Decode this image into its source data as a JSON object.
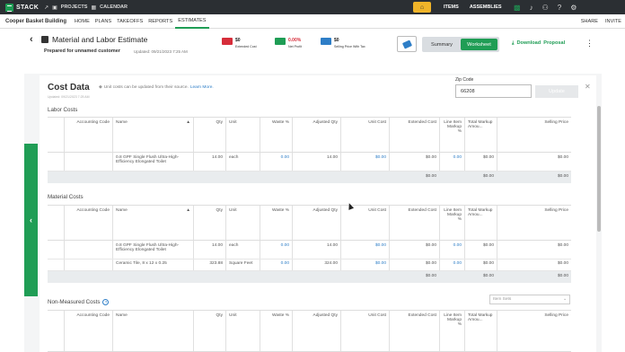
{
  "topbar": {
    "logo": "STACK",
    "nav": [
      {
        "icon": "external-link-icon",
        "glyph": "↗",
        "label": ""
      },
      {
        "icon": "projects-icon",
        "glyph": "▣",
        "label": "PROJECTS"
      },
      {
        "icon": "calendar-icon",
        "glyph": "▦",
        "label": "CALENDAR"
      }
    ],
    "items_label": "ITEMS",
    "assemblies_label": "ASSEMBLIES",
    "icons": [
      "apps-icon",
      "bell-icon",
      "users-icon",
      "help-icon",
      "settings-icon"
    ]
  },
  "subnav": {
    "project": "Cooper Basket Building",
    "items": [
      "HOME",
      "PLANS",
      "TAKEOFFS",
      "REPORTS",
      "ESTIMATES"
    ],
    "active": "ESTIMATES",
    "share": "SHARE",
    "invite": "INVITE"
  },
  "header": {
    "title": "Material and Labor Estimate",
    "prepared": "Prepared for unnamed customer",
    "updated": "Updated: 09/21/2023 7:25 AM",
    "stats": [
      {
        "value": "$0",
        "label": "Extended Cost",
        "color": "#d62d3a"
      },
      {
        "value": "0.00%",
        "label": "Net Profit",
        "color": "#1f9d55",
        "valueColor": "#d62d3a"
      },
      {
        "value": "$0",
        "label": "Selling Price With Tax",
        "color": "#2e7ec7"
      }
    ],
    "summary_label": "Summary",
    "worksheet_label": "Worksheet",
    "download_label": "Download",
    "proposal_label": "Proposal"
  },
  "cost_data": {
    "title": "Cost Data",
    "info": "Unit costs can be updated from their source.",
    "learn_more": "Learn More.",
    "updated": "Updated: 09/21/2023 7:25 AM",
    "zip_label": "Zip Code",
    "zip_value": "66208",
    "update_label": "Update"
  },
  "columns": {
    "accounting": "Accounting Code",
    "name": "Name",
    "qty": "Qty",
    "unit": "Unit",
    "waste": "Waste %",
    "adjusted_qty": "Adjusted Qty",
    "unit_cost": "Unit Cost",
    "extended_cost": "Extended Cost",
    "line_markup": "Line Item Markup %",
    "total_markup": "Total Markup Amou...",
    "selling_price": "Selling Price"
  },
  "labor": {
    "title": "Labor Costs",
    "rows": [
      {
        "name": "0.8 GPF Single Flush Ultra-High-Efficiency Elongated Toilet",
        "qty": "14.00",
        "unit": "each",
        "waste": "0.00",
        "adjusted": "14.00",
        "unit_cost": "$0.00",
        "extended": "$0.00",
        "line_markup": "0.00",
        "total_markup": "$0.00",
        "selling": "$0.00"
      }
    ],
    "total": {
      "extended": "$0.00",
      "total_markup": "$0.00",
      "selling": "$0.00"
    }
  },
  "material": {
    "title": "Material Costs",
    "rows": [
      {
        "name": "0.8 GPF Single Flush Ultra-High-Efficiency Elongated Toilet",
        "qty": "14.00",
        "unit": "each",
        "waste": "0.00",
        "adjusted": "14.00",
        "unit_cost": "$0.00",
        "extended": "$0.00",
        "line_markup": "0.00",
        "total_markup": "$0.00",
        "selling": "$0.00"
      },
      {
        "name": "Ceramic Tile, 8 x 12 x 0.25",
        "qty": "323.88",
        "unit": "Square Feet",
        "waste": "0.00",
        "adjusted": "324.00",
        "unit_cost": "$0.00",
        "extended": "$0.00",
        "line_markup": "0.00",
        "total_markup": "$0.00",
        "selling": "$0.00"
      }
    ],
    "total": {
      "extended": "$0.00",
      "total_markup": "$0.00",
      "selling": "$0.00"
    }
  },
  "non_measured": {
    "title": "Non-Measured Costs",
    "item_sets_placeholder": "Item Sets"
  }
}
